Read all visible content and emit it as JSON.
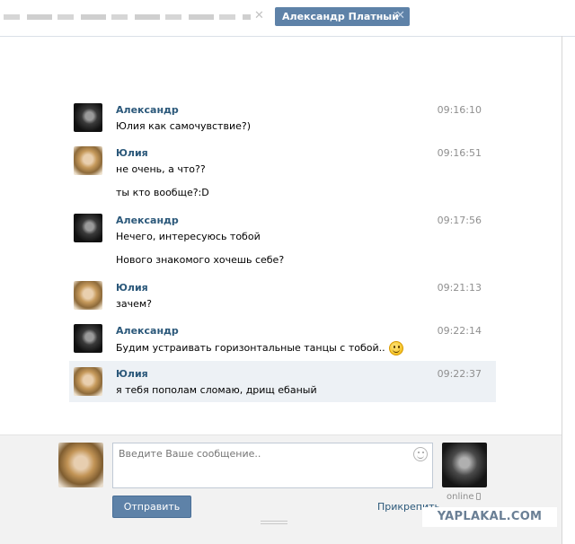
{
  "tabs": {
    "other_tab_label": "",
    "active_tab_label": "Александр Платный"
  },
  "messages": [
    {
      "author": "Александр",
      "time": "09:16:10",
      "lines": [
        "Юлия как самочувствие?)"
      ],
      "avatar": "alex"
    },
    {
      "author": "Юлия",
      "time": "09:16:51",
      "lines": [
        "не очень, а что??",
        "ты кто вообще?:D"
      ],
      "avatar": "yulia"
    },
    {
      "author": "Александр",
      "time": "09:17:56",
      "lines": [
        "Нечего, интересуюсь тобой",
        "Нового знакомого хочешь себе?"
      ],
      "avatar": "alex"
    },
    {
      "author": "Юлия",
      "time": "09:21:13",
      "lines": [
        "зачем?"
      ],
      "avatar": "yulia"
    },
    {
      "author": "Александр",
      "time": "09:22:14",
      "lines": [
        "Будим устраивать горизонтальные танцы с тобой.."
      ],
      "avatar": "alex",
      "emoji": "smile-emoji"
    },
    {
      "author": "Юлия",
      "time": "09:22:37",
      "lines": [
        "я тебя пополам сломаю, дрищ ебаный"
      ],
      "avatar": "yulia",
      "highlighted": true
    }
  ],
  "compose": {
    "placeholder": "Введите Ваше сообщение..",
    "send_label": "Отправить",
    "attach_label": "Прикрепить",
    "peer_status": "online"
  },
  "watermark": "YAPLAKAL.COM",
  "colors": {
    "accent": "#5e82a8",
    "author_link": "#2b587a",
    "highlight_row": "#edf1f5"
  }
}
